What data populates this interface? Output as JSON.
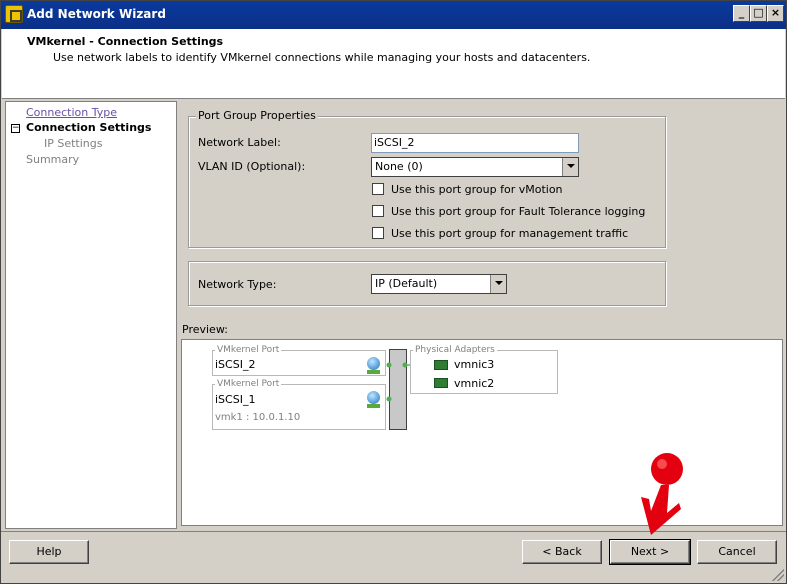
{
  "window": {
    "title": "Add Network Wizard"
  },
  "header": {
    "title": "VMkernel - Connection Settings",
    "subtitle": "Use network labels to identify VMkernel connections while managing your hosts and datacenters."
  },
  "nav": {
    "items": [
      {
        "label": "Connection Type"
      },
      {
        "label": "Connection Settings"
      },
      {
        "label": "IP Settings"
      },
      {
        "label": "Summary"
      }
    ]
  },
  "port_group": {
    "legend": "Port Group Properties",
    "network_label_label": "Network Label:",
    "network_label_value": "iSCSI_2",
    "vlan_label": "VLAN ID (Optional):",
    "vlan_value": "None (0)",
    "checkboxes": [
      {
        "label": "Use this port group for vMotion",
        "checked": false
      },
      {
        "label": "Use this port group for Fault Tolerance logging",
        "checked": false
      },
      {
        "label": "Use this port group for management traffic",
        "checked": false
      }
    ]
  },
  "network_type": {
    "label": "Network Type:",
    "value": "IP (Default)"
  },
  "preview": {
    "label": "Preview:",
    "ports": [
      {
        "group_label": "VMkernel Port",
        "name": "iSCSI_2",
        "detail": ""
      },
      {
        "group_label": "VMkernel Port",
        "name": "iSCSI_1",
        "detail": "vmk1 : 10.0.1.10"
      }
    ],
    "adapters_label": "Physical Adapters",
    "adapters": [
      "vmnic3",
      "vmnic2"
    ]
  },
  "buttons": {
    "help": "Help",
    "back": "< Back",
    "next": "Next >",
    "cancel": "Cancel"
  },
  "colors": {
    "titlebar": "#0b2f86",
    "link": "#6a4fa8",
    "annotation_red": "#e3000f"
  }
}
